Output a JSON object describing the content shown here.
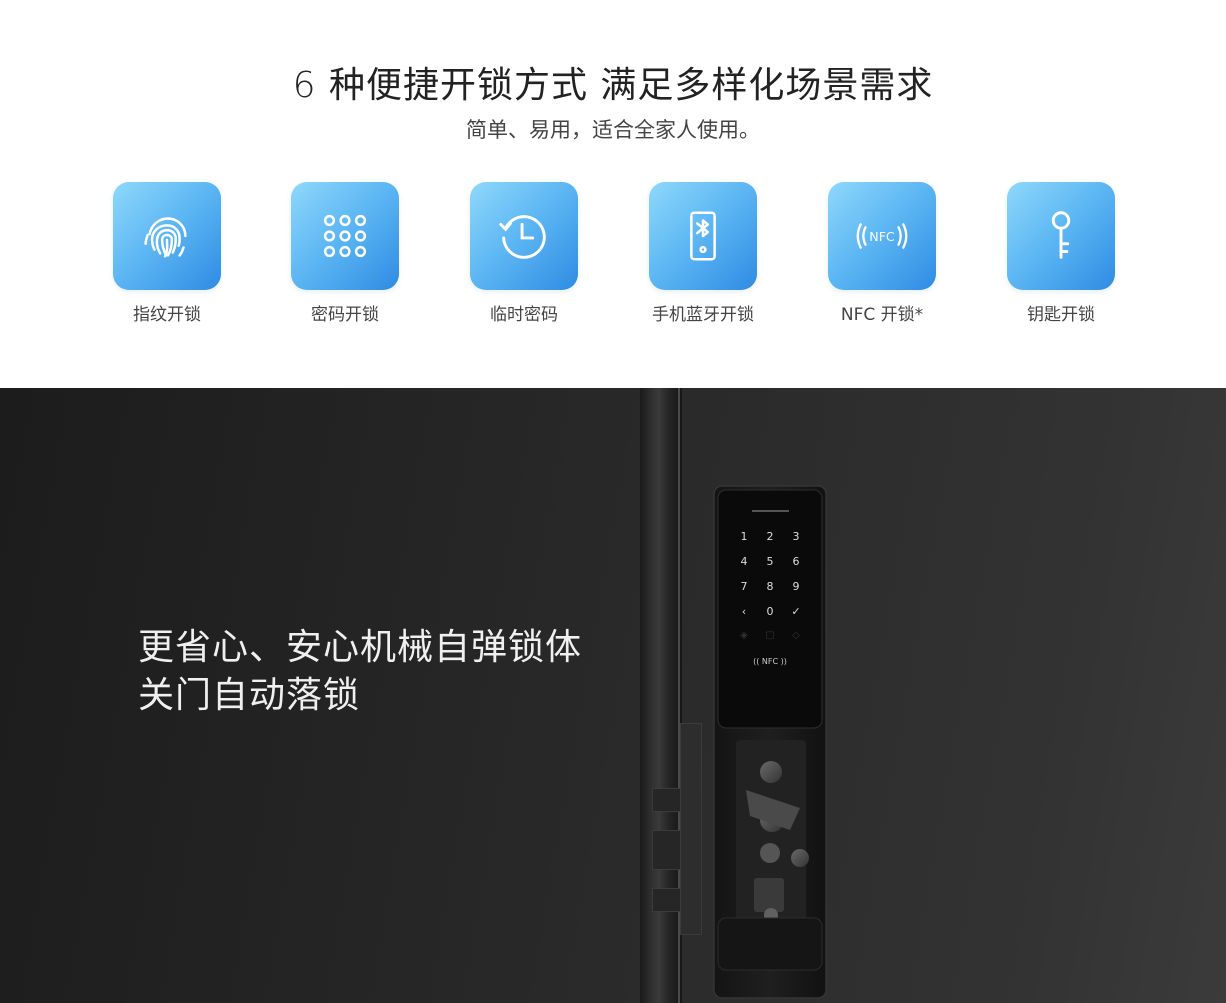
{
  "header": {
    "title": "6 种便捷开锁方式 满足多样化场景需求",
    "subtitle": "简单、易用，适合全家人使用。"
  },
  "methods": [
    {
      "label": "指纹开锁",
      "icon": "fingerprint-icon"
    },
    {
      "label": "密码开锁",
      "icon": "keypad-icon"
    },
    {
      "label": "临时密码",
      "icon": "clock-icon"
    },
    {
      "label": "手机蓝牙开锁",
      "icon": "bluetooth-phone-icon"
    },
    {
      "label": "NFC 开锁*",
      "icon": "nfc-icon"
    },
    {
      "label": "钥匙开锁",
      "icon": "key-icon"
    }
  ],
  "colors": {
    "tile_gradient_start": "#8fd8fb",
    "tile_gradient_end": "#2f8be3",
    "dark_bg": "#262626"
  },
  "feature": {
    "line1": "更省心、安心机械自弹锁体",
    "line2": "关门自动落锁"
  },
  "lock_panel": {
    "keys": [
      "1",
      "2",
      "3",
      "4",
      "5",
      "6",
      "7",
      "8",
      "9",
      "‹",
      "0",
      "✓"
    ],
    "nfc_label": "NFC"
  }
}
